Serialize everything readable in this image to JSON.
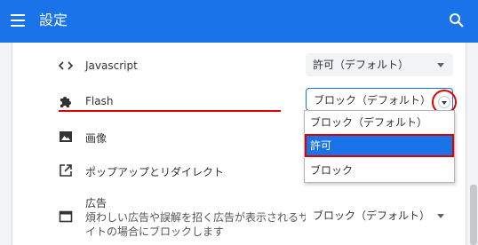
{
  "header": {
    "title": "設定",
    "menu_icon": "hamburger-menu-icon",
    "search_icon": "search-icon"
  },
  "rows": [
    {
      "icon": "code-icon",
      "label": "Javascript",
      "value": "許可（デフォルト）"
    },
    {
      "icon": "puzzle-piece-icon",
      "label": "Flash",
      "value": "ブロック（デフォルト）"
    },
    {
      "icon": "image-icon",
      "label": "画像"
    },
    {
      "icon": "open-in-new-icon",
      "label": "ポップアップとリダイレクト"
    },
    {
      "icon": "web-asset-icon",
      "label": "広告",
      "description_line1": "煩わしい広告や誤解を招く広告が表示されるサ",
      "description_line2": "イトの場合にブロックします",
      "value": "ブロック（デフォルト）"
    }
  ],
  "dropdown": {
    "options": [
      "ブロック（デフォルト）",
      "許可",
      "ブロック"
    ],
    "selected_index": 1
  },
  "colors": {
    "header": "#1a73e8",
    "highlight": "#1a73e8",
    "annotation": "#e00000"
  }
}
